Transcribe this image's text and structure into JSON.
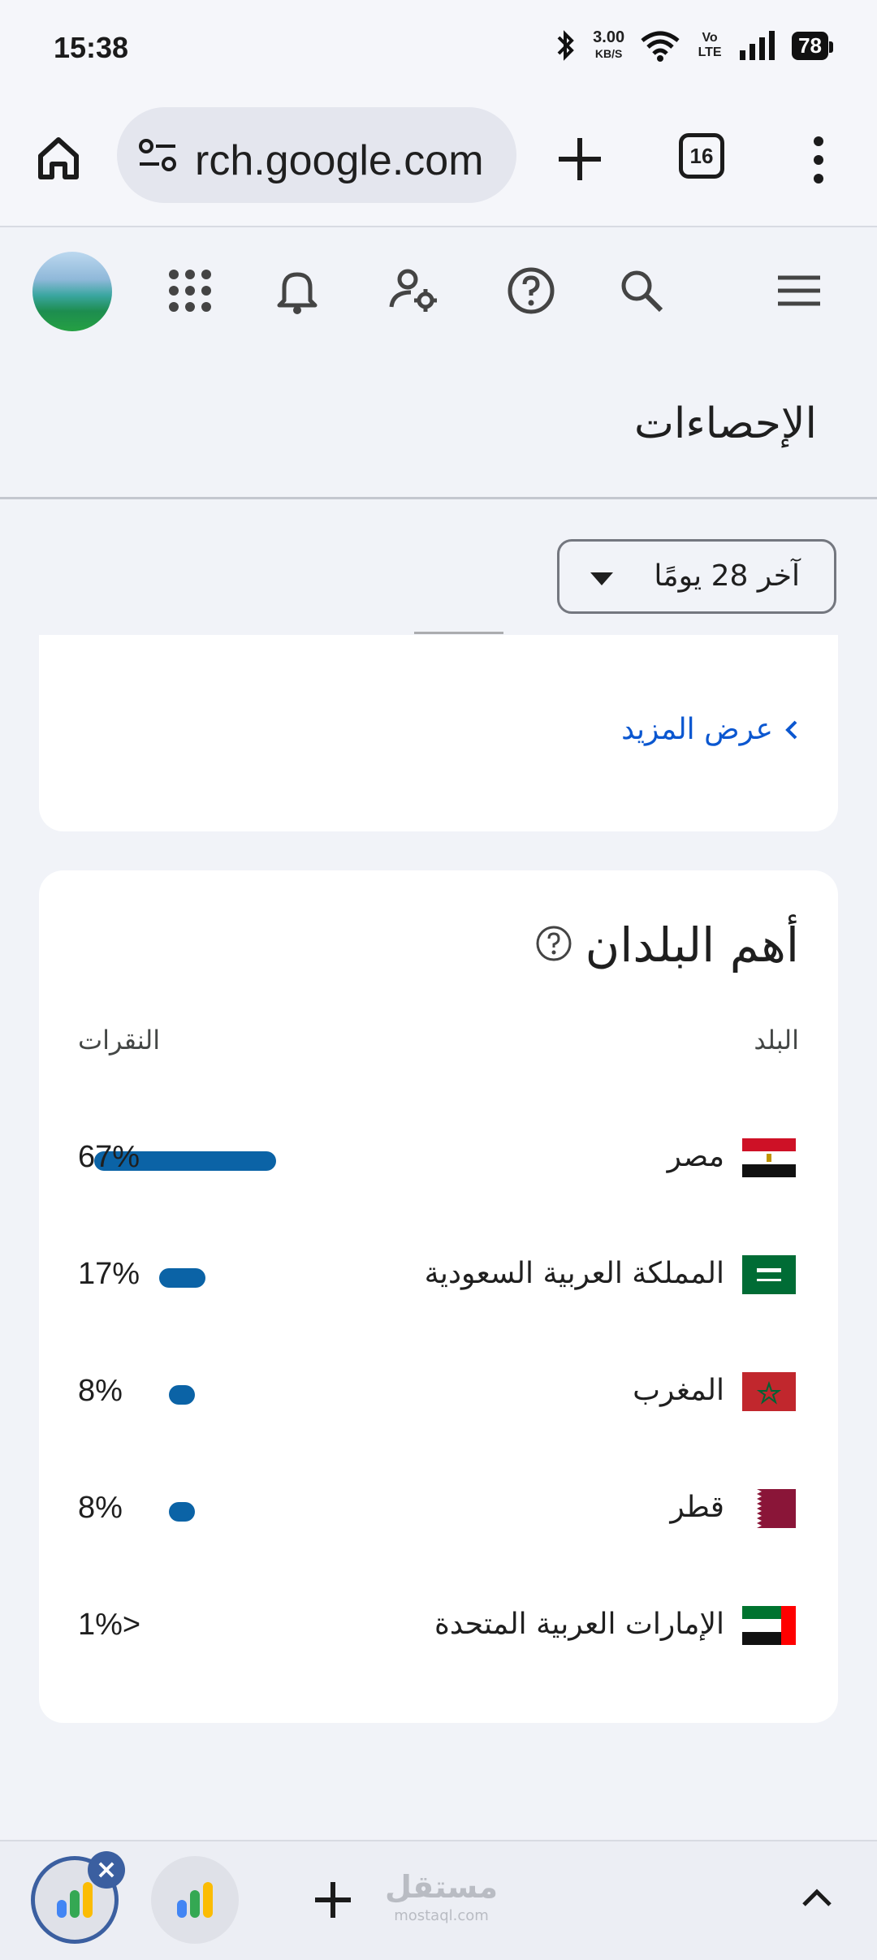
{
  "status_bar": {
    "time": "15:38",
    "net_speed": "3.00",
    "net_unit": "KB/S",
    "volte": "Vo LTE",
    "battery": "78"
  },
  "browser": {
    "url": "rch.google.com",
    "tab_count": "16"
  },
  "page": {
    "title": "الإحصاءات",
    "date_range": "آخر 28 يومًا",
    "show_more": "عرض المزيد"
  },
  "countries_card": {
    "title": "أهم البلدان",
    "col_country": "البلد",
    "col_clicks": "النقرات",
    "rows": [
      {
        "name": "مصر",
        "pct": "67%",
        "share": 0.67
      },
      {
        "name": "المملكة العربية السعودية",
        "pct": "17%",
        "share": 0.17
      },
      {
        "name": "المغرب",
        "pct": "8%",
        "share": 0.08
      },
      {
        "name": "قطر",
        "pct": "8%",
        "share": 0.08
      },
      {
        "name": "الإمارات العربية المتحدة",
        "pct": "1%>",
        "share": 0.0
      }
    ]
  },
  "bottom_bar": {
    "watermark": "مستقل",
    "watermark_sub": "mostaql.com"
  },
  "colors": {
    "accent_link": "#0b57d0",
    "bar": "#0b63a6"
  }
}
